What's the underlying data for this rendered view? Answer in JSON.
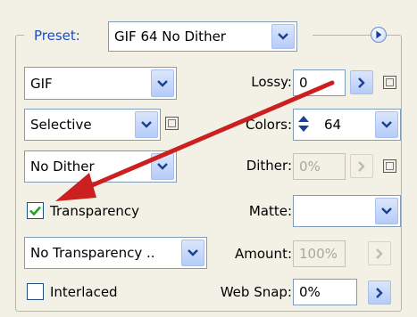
{
  "colors": {
    "accent": "#1f4bc4",
    "arrow": "#cc1f1f"
  },
  "preset": {
    "label": "Preset:",
    "value": "GIF 64 No Dither"
  },
  "left": {
    "format": "GIF",
    "reduction": "Selective",
    "dither_algorithm": "No Dither",
    "transparency_label": "Transparency",
    "transparency_checked": true,
    "transparency_dither": "No Transparency ..",
    "interlaced_label": "Interlaced",
    "interlaced_checked": false
  },
  "right": {
    "lossy_label": "Lossy:",
    "lossy_value": "0",
    "colors_label": "Colors:",
    "colors_value": "64",
    "dither_label": "Dither:",
    "dither_value": "0%",
    "matte_label": "Matte:",
    "matte_value": "",
    "amount_label": "Amount:",
    "amount_value": "100%",
    "websnap_label": "Web Snap:",
    "websnap_value": "0%"
  },
  "icons": {
    "dropdown": "chevron-down-icon",
    "arrow": "chevron-right-icon",
    "menu": "optimize-menu-icon",
    "mask": "channel-mask-icon",
    "check": "checkmark-icon"
  }
}
